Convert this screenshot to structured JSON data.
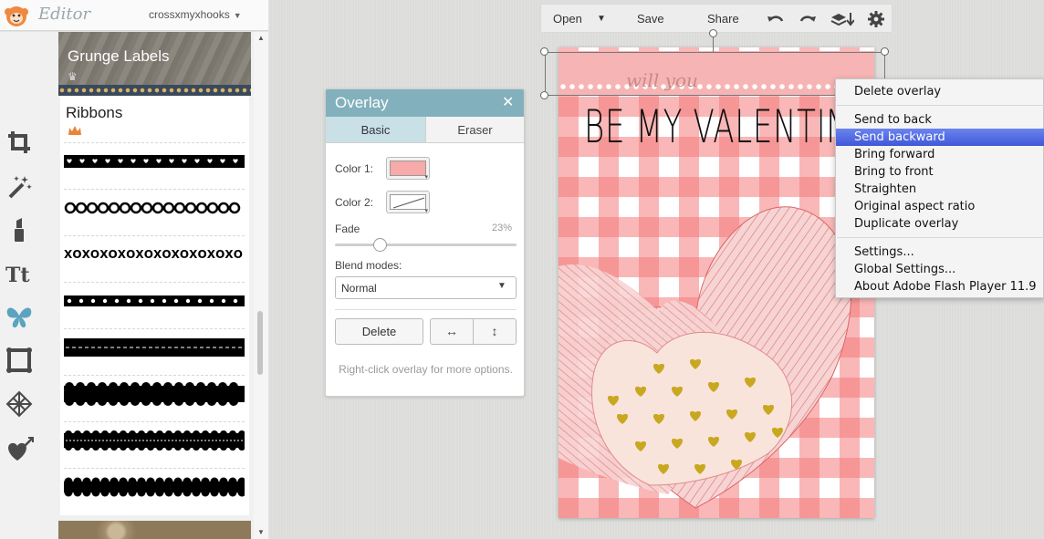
{
  "app": {
    "title": "Editor",
    "user": "crossxmyxhooks"
  },
  "tools": [
    {
      "name": "crop",
      "icon": "crop-icon"
    },
    {
      "name": "effects",
      "icon": "magic-wand-icon"
    },
    {
      "name": "touch-up",
      "icon": "lipstick-icon"
    },
    {
      "name": "text",
      "icon": "text-icon",
      "glyph": "Tt"
    },
    {
      "name": "overlays",
      "icon": "butterfly-icon"
    },
    {
      "name": "frames",
      "icon": "frame-icon"
    },
    {
      "name": "textures",
      "icon": "texture-icon"
    },
    {
      "name": "themes",
      "icon": "heart-arrow-icon"
    }
  ],
  "stickers": {
    "categories": [
      {
        "label": "Grunge Labels",
        "premium": true
      },
      {
        "label": "Ribbons",
        "premium": true
      }
    ],
    "xo_pattern": "XOXOXOXOXOXOXOXOXOXO"
  },
  "toolbar": {
    "open": "Open",
    "save": "Save",
    "share": "Share"
  },
  "canvas": {
    "line1": "will you",
    "line2": "BE MY VALENTINE"
  },
  "overlay_panel": {
    "title": "Overlay",
    "tabs": [
      "Basic",
      "Eraser"
    ],
    "active_tab": "Basic",
    "color1_label": "Color 1:",
    "color1_value": "#f8a9a9",
    "color2_label": "Color 2:",
    "fade_label": "Fade",
    "fade_value": "23%",
    "blend_label": "Blend modes:",
    "blend_value": "Normal",
    "delete_label": "Delete",
    "hint": "Right-click overlay for more options."
  },
  "context_menu": {
    "items": [
      {
        "label": "Delete overlay",
        "active": false
      },
      {
        "label": "Send to back",
        "active": false
      },
      {
        "label": "Send backward",
        "active": true
      },
      {
        "label": "Bring forward",
        "active": false
      },
      {
        "label": "Bring to front",
        "active": false
      },
      {
        "label": "Straighten",
        "active": false
      },
      {
        "label": "Original aspect ratio",
        "active": false
      },
      {
        "label": "Duplicate overlay",
        "active": false
      },
      {
        "label": "Settings...",
        "active": false
      },
      {
        "label": "Global Settings...",
        "active": false
      },
      {
        "label": "About Adobe Flash Player 11.9",
        "active": false
      }
    ]
  },
  "colors": {
    "accent": "#82b0bc",
    "tool_icon": "#4a4a4a",
    "active_tool": "#5ba3c0",
    "menu_highlight": "#4a63e0",
    "gingham": "#f47c7c",
    "heart_gold": "#c8a820"
  }
}
